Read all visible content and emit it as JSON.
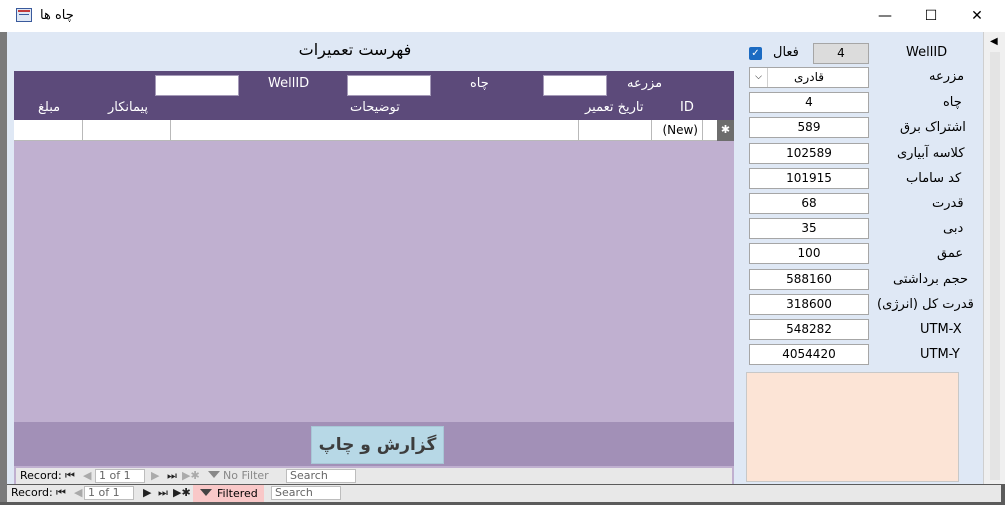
{
  "window": {
    "title": "چاه ها",
    "minimize": "—",
    "maximize": "☐",
    "close": "✕"
  },
  "repairs": {
    "title": "فهرست تعمیرات",
    "filters": {
      "farm_label": "مزرعه",
      "well_label": "چاه",
      "wellid_label": "WellID"
    },
    "columns": {
      "id": "ID",
      "date": "تاریخ تعمیر",
      "desc": "توضیحات",
      "contractor": "پیمانکار",
      "amount": "مبلغ"
    },
    "new_row": {
      "id": "(New)",
      "selector": "✱"
    },
    "report_button": "گزارش و چاپ",
    "nav": {
      "record_label": "Record:",
      "record_value": "1 of 1",
      "no_filter": "No Filter",
      "search": "Search"
    }
  },
  "well": {
    "wellid_label": "WellID",
    "wellid_value": "4",
    "active_label": "فعال",
    "active_checked": "✓",
    "farm_label": "مزرعه",
    "farm_value": "قادری",
    "well_label": "چاه",
    "well_value": "4",
    "fields": [
      {
        "label": "اشتراک برق",
        "value": "589"
      },
      {
        "label": "کلاسه آبیاری",
        "value": "102589"
      },
      {
        "label": "کد ساماب",
        "value": "101915"
      },
      {
        "label": "قدرت",
        "value": "68"
      },
      {
        "label": "دبی",
        "value": "35"
      },
      {
        "label": "عمق",
        "value": "100"
      },
      {
        "label": "حجم برداشتی",
        "value": "588160"
      },
      {
        "label": "قدرت کل (انرژی)",
        "value": "318600"
      },
      {
        "label": "UTM-X",
        "value": "548282"
      },
      {
        "label": "UTM-Y",
        "value": "4054420"
      }
    ]
  },
  "main_nav": {
    "record_label": "Record:",
    "record_value": "1 of 1",
    "filtered": "Filtered",
    "search": "Search"
  },
  "colors": {
    "header": "#5c4a7a",
    "subform_bg": "#c0b0d0",
    "report_button": "#b7d8e6",
    "memo_bg": "#fce4d6"
  }
}
